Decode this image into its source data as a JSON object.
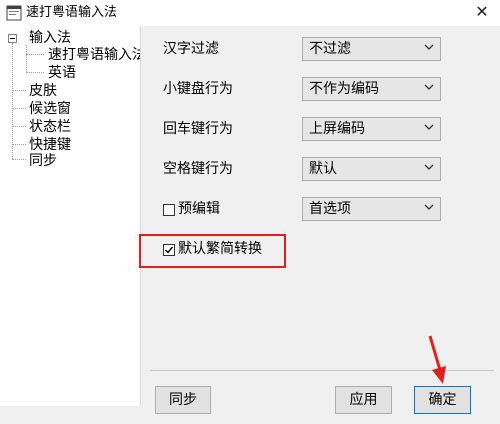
{
  "window": {
    "title": "速打粤语输入法",
    "close_glyph": "✕"
  },
  "tree": {
    "items": [
      {
        "label": "输入法"
      },
      {
        "label": "速打粤语输入法"
      },
      {
        "label": "英语"
      },
      {
        "label": "皮肤"
      },
      {
        "label": "候选窗"
      },
      {
        "label": "状态栏"
      },
      {
        "label": "快捷键"
      },
      {
        "label": "同步"
      }
    ]
  },
  "settings": {
    "hanzi_filter": {
      "label": "汉字过滤",
      "value": "不过滤"
    },
    "keypad_behavior": {
      "label": "小键盘行为",
      "value": "不作为编码"
    },
    "enter_behavior": {
      "label": "回车键行为",
      "value": "上屏编码"
    },
    "space_behavior": {
      "label": "空格键行为",
      "value": "默认"
    },
    "pre_edit": {
      "label": "预编辑",
      "checked": false,
      "value": "首选项"
    },
    "trad_simp": {
      "label": "默认繁简转换",
      "checked": true
    }
  },
  "buttons": {
    "sync": "同步",
    "apply": "应用",
    "ok": "确定"
  },
  "colors": {
    "highlight": "#e02020",
    "ok_border": "#0078d7"
  }
}
